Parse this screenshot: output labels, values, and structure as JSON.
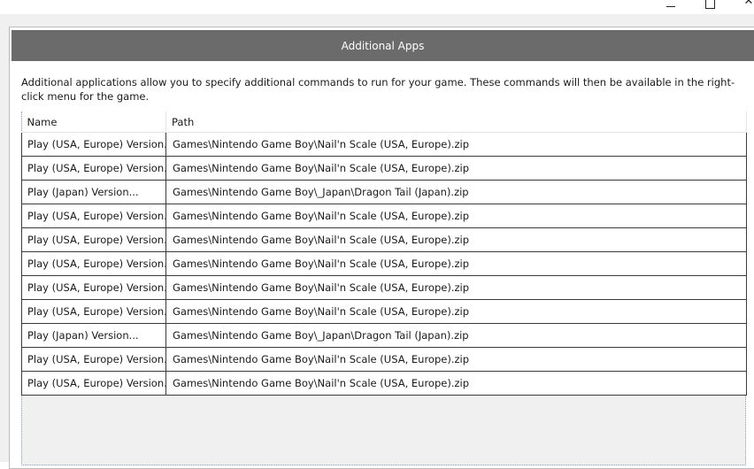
{
  "window": {
    "minimize_glyph": "",
    "maximize_glyph": "",
    "close_glyph": "✕"
  },
  "dialog": {
    "title": "Additional Apps",
    "description": "Additional applications allow you to specify additional commands to run for your game.  These commands will then be available in the right-click menu for the game."
  },
  "table": {
    "columns": [
      "Name",
      "Path"
    ],
    "rows": [
      {
        "name": "Play (USA, Europe) Version...",
        "path": "Games\\Nintendo Game Boy\\Nail'n Scale (USA, Europe).zip"
      },
      {
        "name": "Play (USA, Europe) Version...",
        "path": "Games\\Nintendo Game Boy\\Nail'n Scale (USA, Europe).zip"
      },
      {
        "name": "Play (Japan) Version...",
        "path": "Games\\Nintendo Game Boy\\_Japan\\Dragon Tail (Japan).zip"
      },
      {
        "name": "Play (USA, Europe) Version...",
        "path": "Games\\Nintendo Game Boy\\Nail'n Scale (USA, Europe).zip"
      },
      {
        "name": "Play (USA, Europe) Version...",
        "path": "Games\\Nintendo Game Boy\\Nail'n Scale (USA, Europe).zip"
      },
      {
        "name": "Play (USA, Europe) Version...",
        "path": "Games\\Nintendo Game Boy\\Nail'n Scale (USA, Europe).zip"
      },
      {
        "name": "Play (USA, Europe) Version...",
        "path": "Games\\Nintendo Game Boy\\Nail'n Scale (USA, Europe).zip"
      },
      {
        "name": "Play (USA, Europe) Version...",
        "path": "Games\\Nintendo Game Boy\\Nail'n Scale (USA, Europe).zip"
      },
      {
        "name": "Play (Japan) Version...",
        "path": "Games\\Nintendo Game Boy\\_Japan\\Dragon Tail (Japan).zip"
      },
      {
        "name": "Play (USA, Europe) Version...",
        "path": "Games\\Nintendo Game Boy\\Nail'n Scale (USA, Europe).zip"
      },
      {
        "name": "Play (USA, Europe) Version...",
        "path": "Games\\Nintendo Game Boy\\Nail'n Scale (USA, Europe).zip"
      }
    ]
  },
  "colors": {
    "header_bg": "#6b6b6b",
    "header_text": "#ffffff",
    "grid_bg": "#f0f0f0",
    "cell_border": "#3a3a3a"
  }
}
